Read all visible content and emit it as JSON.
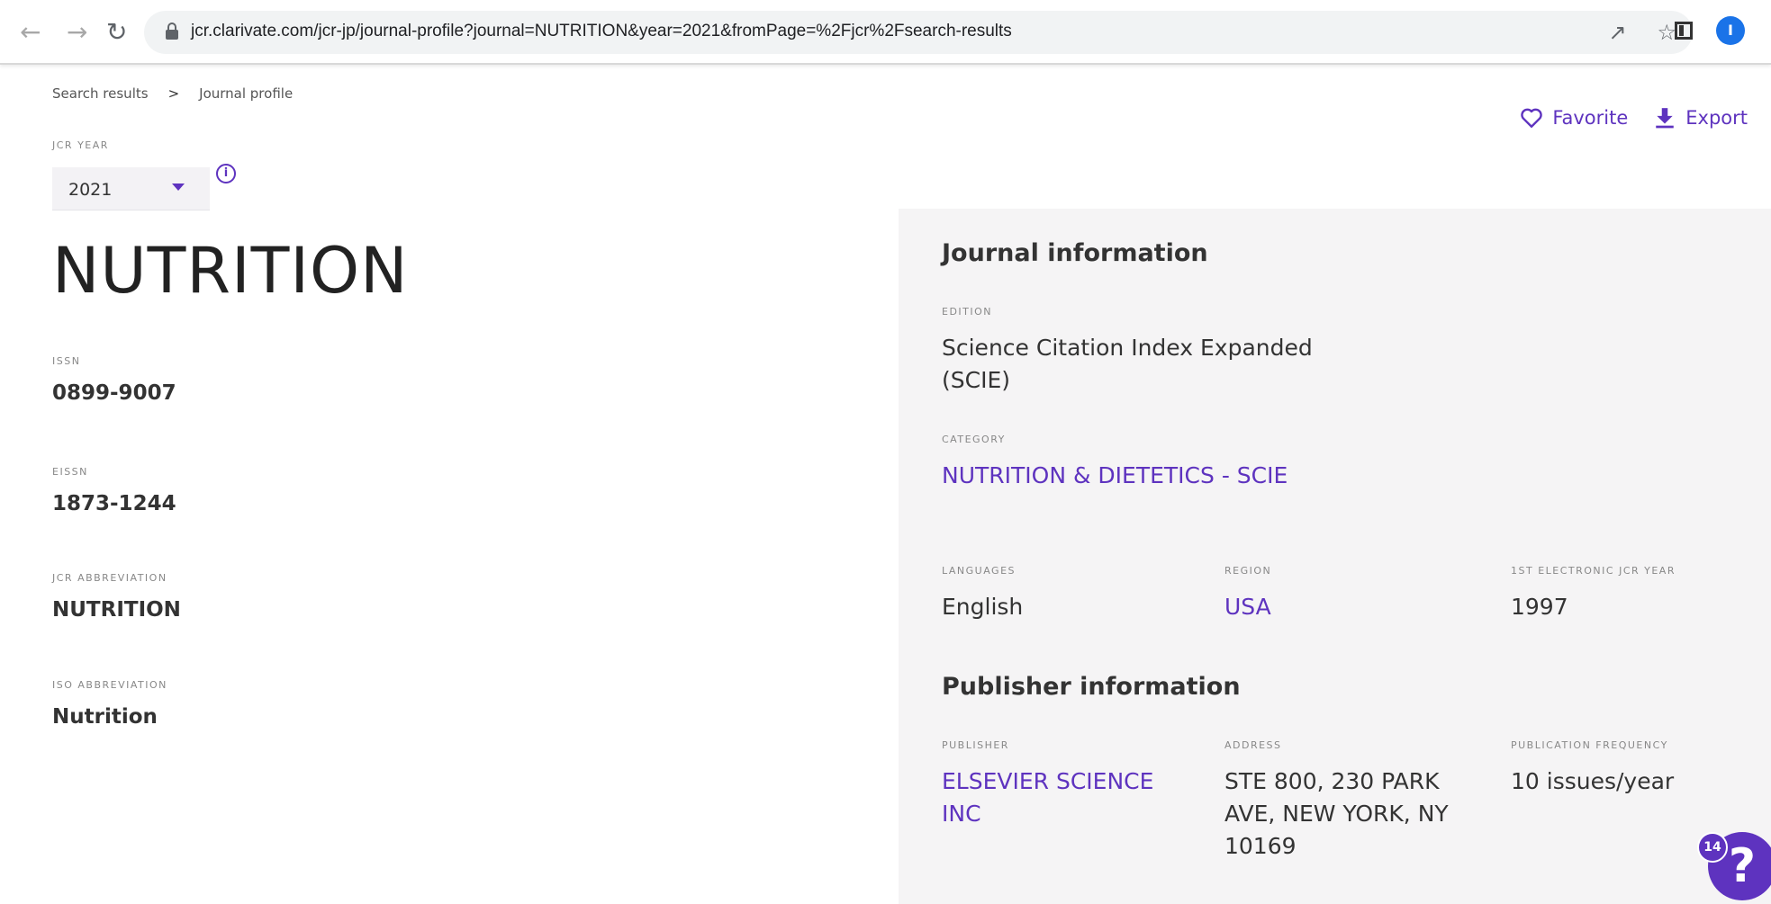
{
  "browser": {
    "url": "jcr.clarivate.com/jcr-jp/journal-profile?journal=NUTRITION&year=2021&fromPage=%2Fjcr%2Fsearch-results",
    "profile_initial": "I",
    "icons": [
      "back-arrow-icon",
      "forward-arrow-icon",
      "reload-icon",
      "lock-icon",
      "share-icon",
      "bookmark-star-icon",
      "side-panel-icon",
      "profile-icon",
      "more-menu-icon"
    ]
  },
  "breadcrumb": {
    "items": [
      "Search results",
      "Journal profile"
    ],
    "separator": ">"
  },
  "jcr_year": {
    "label": "JCR YEAR",
    "selected": "2021"
  },
  "actions": {
    "favorite": "Favorite",
    "export": "Export"
  },
  "journal": {
    "title": "NUTRITION",
    "issn_label": "ISSN",
    "issn": "0899-9007",
    "eissn_label": "EISSN",
    "eissn": "1873-1244",
    "jcr_abbr_label": "JCR ABBREVIATION",
    "jcr_abbr": "NUTRITION",
    "iso_abbr_label": "ISO ABBREVIATION",
    "iso_abbr": "Nutrition"
  },
  "journal_info": {
    "heading": "Journal information",
    "edition_label": "EDITION",
    "edition": "Science Citation Index Expanded (SCIE)",
    "category_label": "CATEGORY",
    "category": "NUTRITION & DIETETICS - SCIE",
    "languages_label": "LANGUAGES",
    "languages": "English",
    "region_label": "REGION",
    "region": "USA",
    "first_year_label": "1ST ELECTRONIC JCR YEAR",
    "first_year": "1997"
  },
  "publisher_info": {
    "heading": "Publisher information",
    "publisher_label": "PUBLISHER",
    "publisher": "ELSEVIER SCIENCE INC",
    "address_label": "ADDRESS",
    "address": "STE 800, 230 PARK AVE, NEW YORK, NY 10169",
    "frequency_label": "PUBLICATION FREQUENCY",
    "frequency": "10 issues/year"
  },
  "help": {
    "badge": "14",
    "symbol": "?"
  },
  "colors": {
    "accent": "#5e33bf",
    "panel_bg": "#f5f4f5",
    "profile_blue": "#1a73e8"
  }
}
